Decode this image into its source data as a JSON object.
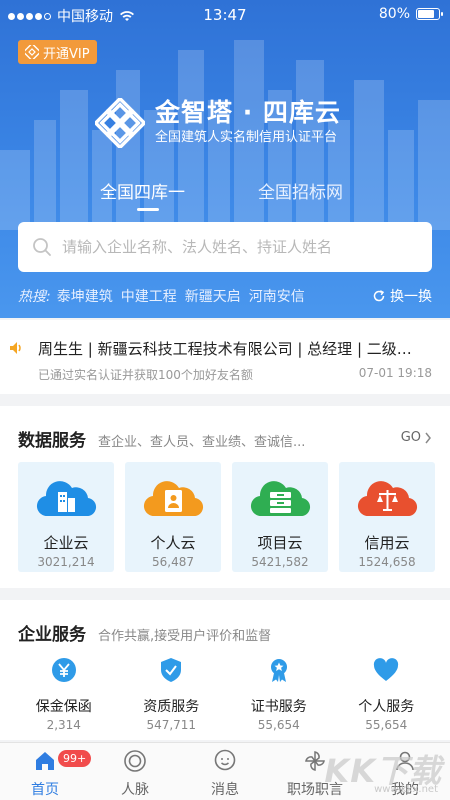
{
  "statusbar": {
    "carrier": "中国移动",
    "time": "13:47",
    "battery": "80%",
    "battery_level": 0.8
  },
  "vip": {
    "label": "开通VIP"
  },
  "brand": {
    "title": "金智塔 · 四库云",
    "subtitle": "全国建筑人实名制信用认证平台"
  },
  "hero_tabs": [
    {
      "label": "全国四库一"
    },
    {
      "label": "全国招标网"
    }
  ],
  "search": {
    "placeholder": "请输入企业名称、法人姓名、持证人姓名"
  },
  "hot": {
    "label": "热搜:",
    "items": [
      "泰坤建筑",
      "中建工程",
      "新疆天启",
      "河南安信"
    ],
    "refresh": "换一换"
  },
  "notice": {
    "title": "周生生 | 新疆云科技工程技术有限公司 | 总经理 | 二级…",
    "subtitle": "已通过实名认证并获取100个加好友名额",
    "time": "07-01 19:18"
  },
  "data_services": {
    "title": "数据服务",
    "desc": "查企业、查人员、查业绩、查诚信...",
    "go": "GO",
    "cards": [
      {
        "name": "企业云",
        "count": "3021,214",
        "color": "#1f8ee5",
        "icon": "building-cloud-icon"
      },
      {
        "name": "个人云",
        "count": "56,487",
        "color": "#f39a1e",
        "icon": "contact-cloud-icon"
      },
      {
        "name": "项目云",
        "count": "5421,582",
        "color": "#2fae52",
        "icon": "server-cloud-icon"
      },
      {
        "name": "信用云",
        "count": "1524,658",
        "color": "#e8502f",
        "icon": "scale-cloud-icon"
      }
    ]
  },
  "enterprise_services": {
    "title": "企业服务",
    "desc": "合作共赢,接受用户评价和监督",
    "items": [
      {
        "name": "保金保函",
        "count": "2,314",
        "icon": "yen-icon"
      },
      {
        "name": "资质服务",
        "count": "547,711",
        "icon": "shield-check-icon"
      },
      {
        "name": "证书服务",
        "count": "55,654",
        "icon": "award-icon"
      },
      {
        "name": "个人服务",
        "count": "55,654",
        "icon": "heart-icon"
      }
    ]
  },
  "tabbar": {
    "badge": "99+",
    "items": [
      {
        "label": "首页",
        "icon": "home-icon"
      },
      {
        "label": "人脉",
        "icon": "contacts-icon"
      },
      {
        "label": "消息",
        "icon": "message-icon"
      },
      {
        "label": "职场职言",
        "icon": "pinwheel-icon"
      },
      {
        "label": "我的",
        "icon": "profile-icon"
      }
    ]
  },
  "watermark": {
    "text": "KK下载",
    "url": "www.kkx.net"
  },
  "colors": {
    "primary": "#2f7de1",
    "vip": "#f29a3b",
    "badge": "#f14c4c"
  }
}
